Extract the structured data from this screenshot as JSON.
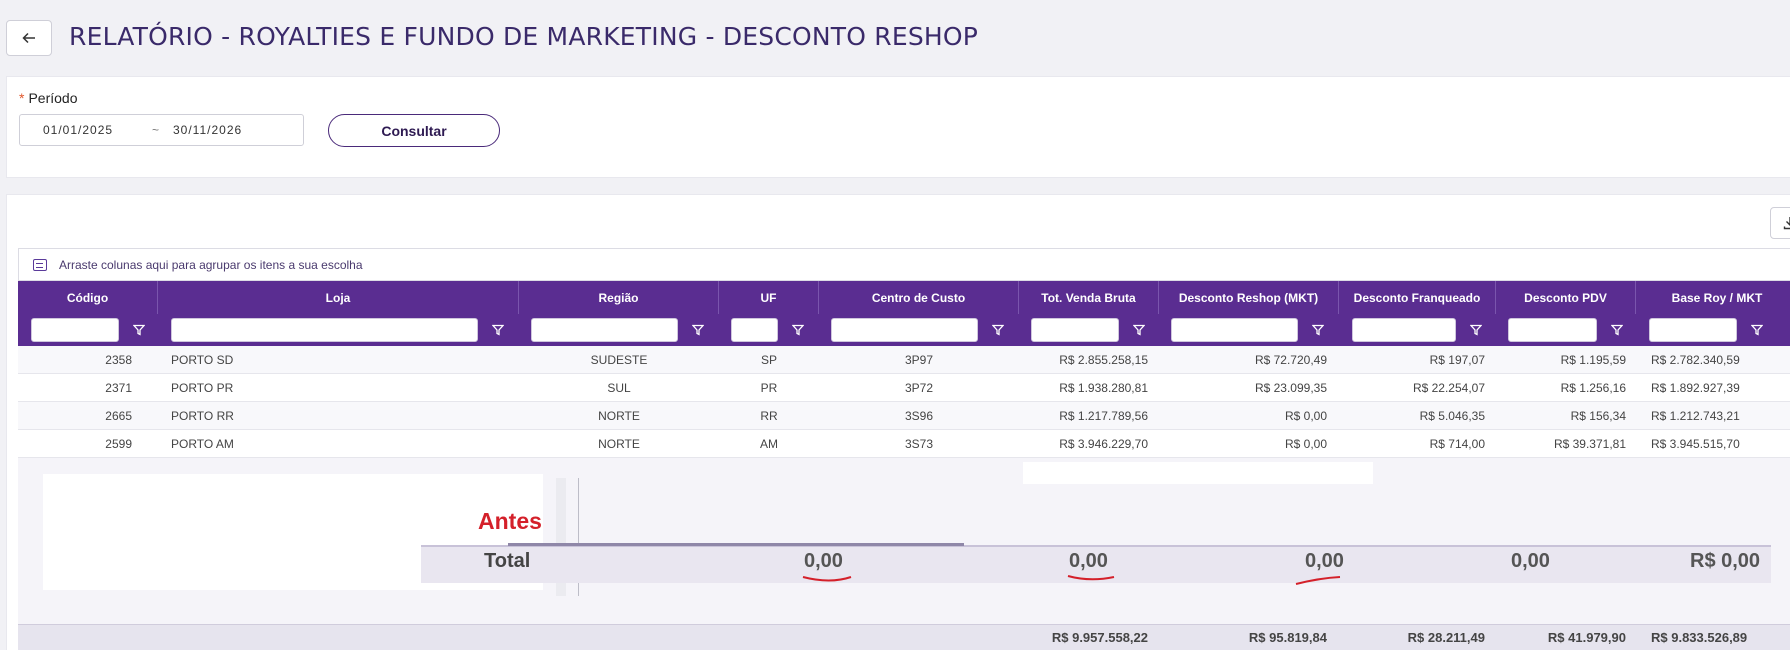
{
  "header": {
    "title": "RELATÓRIO - ROYALTIES E FUNDO DE MARKETING - DESCONTO RESHOP"
  },
  "filters": {
    "period_label": "Período",
    "required_mark": "*",
    "start_date": "01/01/2025",
    "range_separator": "~",
    "end_date": "30/11/2026",
    "consult_label": "Consultar"
  },
  "grid": {
    "group_panel_text": "Arraste colunas aqui para agrupar os itens a sua escolha",
    "columns": [
      "Código",
      "Loja",
      "Região",
      "UF",
      "Centro de Custo",
      "Tot. Venda Bruta",
      "Desconto Reshop (MKT)",
      "Desconto Franqueado",
      "Desconto PDV",
      "Base Roy / MKT"
    ],
    "rows": [
      [
        "2358",
        "PORTO SD",
        "SUDESTE",
        "SP",
        "3P97",
        "R$ 2.855.258,15",
        "R$ 72.720,49",
        "R$ 197,07",
        "R$ 1.195,59",
        "R$ 2.782.340,59"
      ],
      [
        "2371",
        "PORTO PR",
        "SUL",
        "PR",
        "3P72",
        "R$ 1.938.280,81",
        "R$ 23.099,35",
        "R$ 22.254,07",
        "R$ 1.256,16",
        "R$ 1.892.927,39"
      ],
      [
        "2665",
        "PORTO RR",
        "NORTE",
        "RR",
        "3S96",
        "R$ 1.217.789,56",
        "R$ 0,00",
        "R$ 5.046,35",
        "R$ 156,34",
        "R$ 1.212.743,21"
      ],
      [
        "2599",
        "PORTO AM",
        "NORTE",
        "AM",
        "3S73",
        "R$ 3.946.229,70",
        "R$ 0,00",
        "R$ 714,00",
        "R$ 39.371,81",
        "R$ 3.945.515,70"
      ]
    ],
    "footer_totals": [
      "R$ 9.957.558,22",
      "R$ 95.819,84",
      "R$ 28.211,49",
      "R$ 41.979,90",
      "R$ 9.833.526,89"
    ]
  },
  "annotation": {
    "label": "Antes",
    "total_label": "Total",
    "values": [
      "0,00",
      "0,00",
      "0,00",
      "0,00",
      "R$ 0,00"
    ],
    "underline_color": "#d4202a"
  },
  "theme": {
    "header_bg": "#5a2d91",
    "title_color": "#3a2a6a"
  }
}
